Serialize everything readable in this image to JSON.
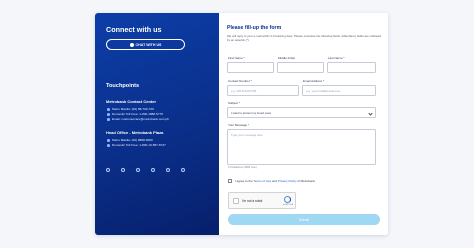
{
  "left": {
    "title": "Connect with us",
    "chat_label": "CHAT WITH US",
    "touchpoints_title": "Touchpoints",
    "contact_center": {
      "title": "Metrobank Contact Center",
      "lines": [
        "Metro Manila: (02) 88-700-700",
        "Domestic Toll Free: 1-800-1888-5775",
        "Email: customercare@metrobank.com.ph"
      ]
    },
    "head_office": {
      "title": "Head Office - Metrobank Plaza",
      "lines": [
        "Metro Manila: (02) 8898-8000",
        "Domestic Toll Free: 1-800-10-857-8727"
      ]
    },
    "socials": [
      "facebook-icon",
      "twitter-icon",
      "youtube-icon",
      "linkedin-icon",
      "viber-icon",
      "instagram-icon"
    ]
  },
  "form": {
    "title": "Please fill-up the form",
    "intro": "We will reply to your e-mail within 2-3 banking days. Please complete the following fields. (Mandatory fields are indicated by an asterisk (*).",
    "first_name_label": "First Name *",
    "middle_initial_label": "Middle Initial",
    "last_name_label": "Last Name *",
    "contact_label": "Contact Number *",
    "contact_placeholder": "e.g. 09171234X766",
    "email_label": "Email Address *",
    "email_placeholder": "e.g. youremail@email.com",
    "subject_label": "Subject *",
    "subject_value": "I want to protect my loved ones",
    "message_label": "Your Message *",
    "message_placeholder": "Type your message here",
    "counter": "0 Characters (3000 max)",
    "agree_prefix": "I agree to the ",
    "terms": "Terms of Use",
    "and": " and ",
    "privacy": "Privacy Policy",
    "agree_suffix": " of Metrobank.",
    "captcha_text": "I'm not a robot",
    "captcha_brand": "reCAPTCHA",
    "submit_label": "Submit"
  }
}
